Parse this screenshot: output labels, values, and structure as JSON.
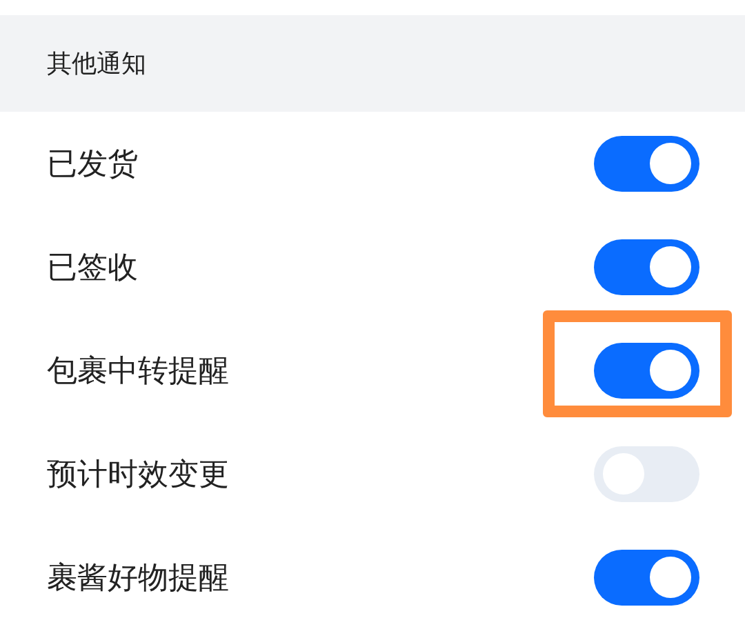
{
  "section": {
    "title": "其他通知"
  },
  "rows": [
    {
      "label": "已发货",
      "on": true,
      "highlighted": false
    },
    {
      "label": "已签收",
      "on": true,
      "highlighted": false
    },
    {
      "label": "包裹中转提醒",
      "on": true,
      "highlighted": true
    },
    {
      "label": "预计时效变更",
      "on": false,
      "highlighted": false
    },
    {
      "label": "裹酱好物提醒",
      "on": true,
      "highlighted": false
    }
  ]
}
